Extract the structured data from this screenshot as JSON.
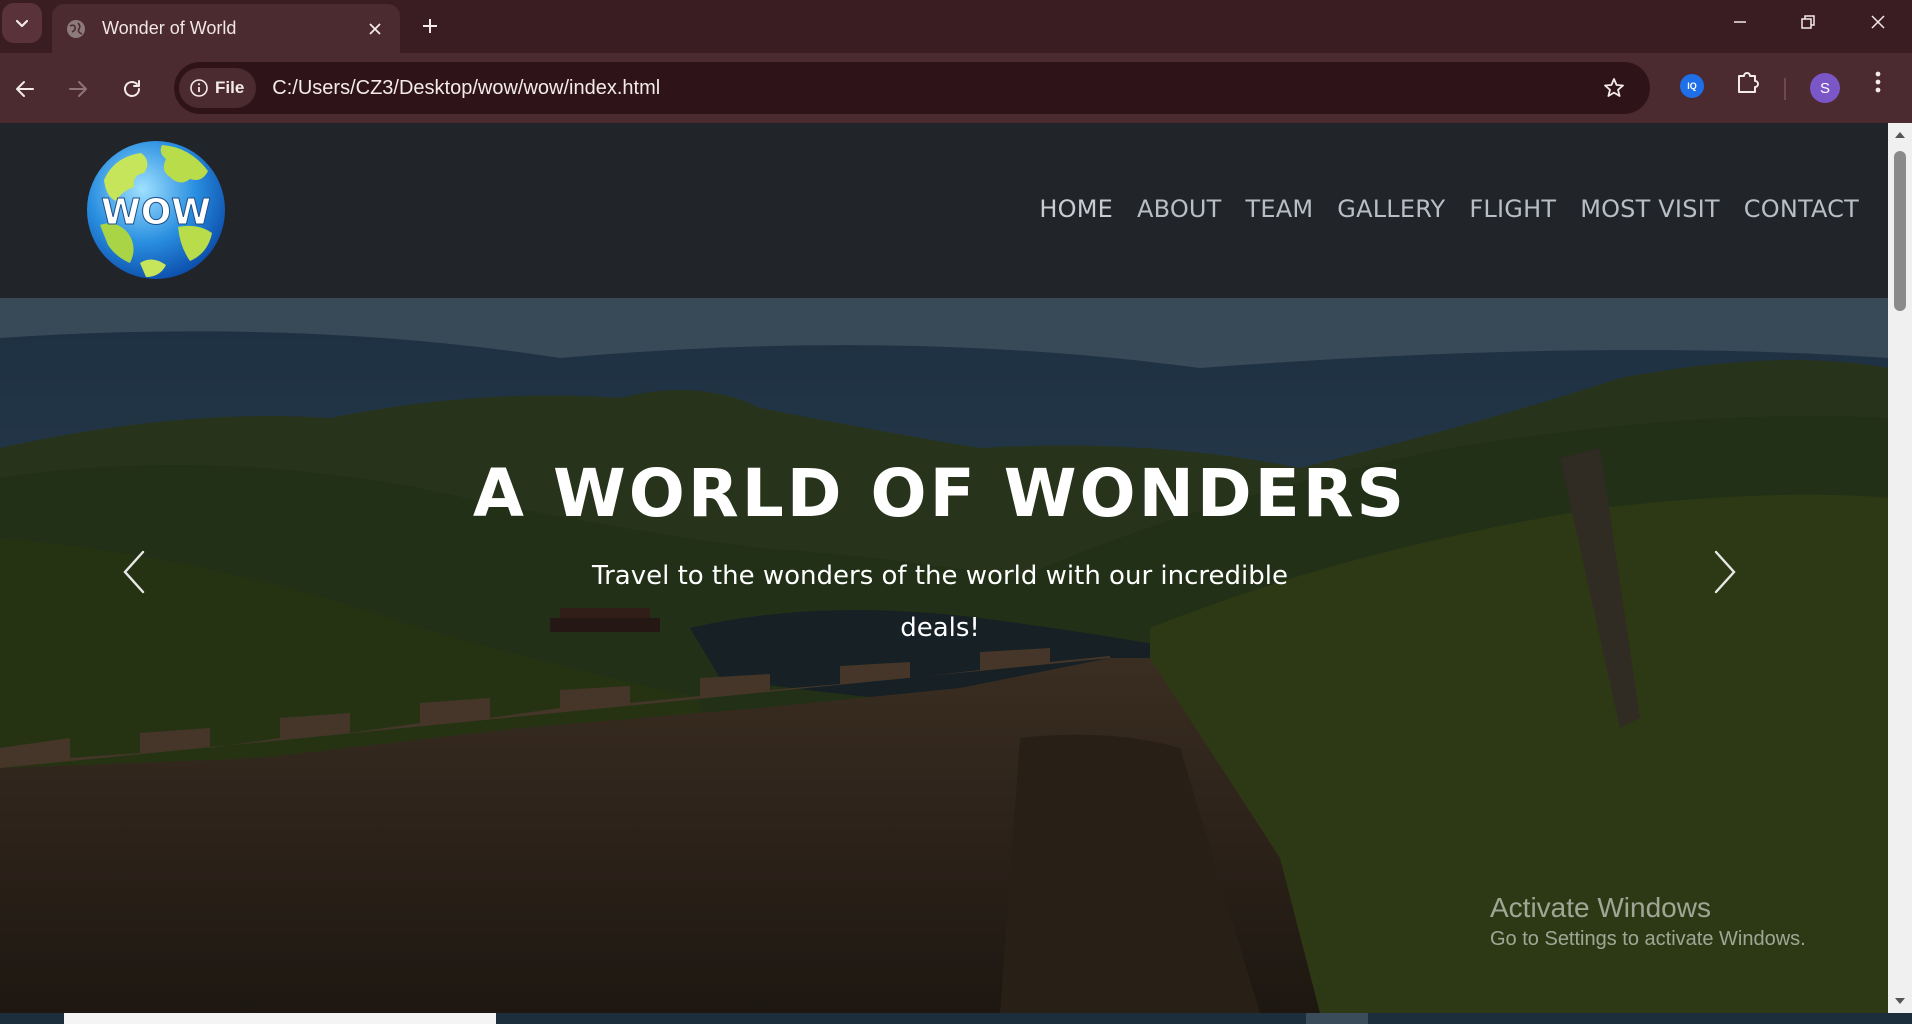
{
  "browser": {
    "tab_title": "Wonder of World",
    "url_scheme_label": "File",
    "url": "C:/Users/CZ3/Desktop/wow/wow/index.html",
    "profile_initial": "S",
    "extension_badge": "IQ"
  },
  "site": {
    "logo_text": "WOW",
    "nav": [
      "HOME",
      "ABOUT",
      "TEAM",
      "GALLERY",
      "FLIGHT",
      "MOST VISIT",
      "CONTACT"
    ]
  },
  "hero": {
    "title": "A WORLD OF WONDERS",
    "subtitle": "Travel to the wonders of the world with our incredible deals!"
  },
  "os": {
    "activate_title": "Activate Windows",
    "activate_sub": "Go to Settings to activate Windows."
  },
  "colors": {
    "tabbar": "#3a1d22",
    "toolbar": "#4b2a30",
    "header": "#212529",
    "nav_text": "#b9bec4"
  }
}
